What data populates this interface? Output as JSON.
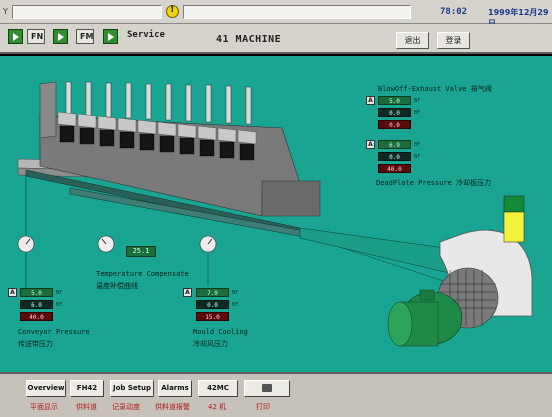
{
  "header": {
    "side_mark": "Y",
    "clock": "78:02",
    "date": "1999年12月29日",
    "mode_fn": "FN",
    "mode_fm": "FM",
    "service": "Service",
    "machine_title": "41 MACHINE",
    "exit_label": "退出",
    "login_label": "登录"
  },
  "blowoff": {
    "title": "BlowOff-Exhaust Valve 排气阀",
    "set": "5.0",
    "actual": "0.0",
    "alarm": "0.0",
    "units": [
      "BF",
      "BF",
      "BF"
    ]
  },
  "deadplate": {
    "title": "DeadPlate Pressure 冷却板压力",
    "set": "6.9",
    "actual": "0.0",
    "alarm": "40.0",
    "units": [
      "BF",
      "BF",
      "BF"
    ]
  },
  "temperature": {
    "value": "25.1",
    "title": "Temperature Compensate",
    "title_cn": "温度补偿曲线"
  },
  "conveyor": {
    "title": "Conveyor Pressure",
    "title_cn": "传送带压力",
    "set": "5.0",
    "actual": "6.0",
    "alarm": "40.0",
    "units": [
      "BF",
      "BF",
      "BF"
    ]
  },
  "mould": {
    "title": "Mould Cooling",
    "title_cn": "冷却风压力",
    "set": "7.9",
    "actual": "0.0",
    "alarm": "15.0",
    "units": [
      "BF",
      "BF",
      "BF"
    ]
  },
  "nav": {
    "overview": "Overview",
    "overview_cn": "平面显示",
    "fh42": "FH42",
    "fh42_cn": "供料道",
    "job_setup": "Job Setup",
    "job_setup_cn": "记录动度",
    "alarms": "Alarms",
    "alarms_cn": "供料道报警",
    "fourtwo_mc": "42MC",
    "fourtwo_mc_cn": "42 机",
    "print_cn": "打印"
  },
  "colors": {
    "process_bg": "#19a591",
    "motor": "#1f8a47",
    "level_top": "#138a35",
    "level_bottom": "#f2f23a"
  },
  "icons": [
    "warning-icon",
    "play-icon",
    "printer-icon",
    "gauge-icon"
  ]
}
